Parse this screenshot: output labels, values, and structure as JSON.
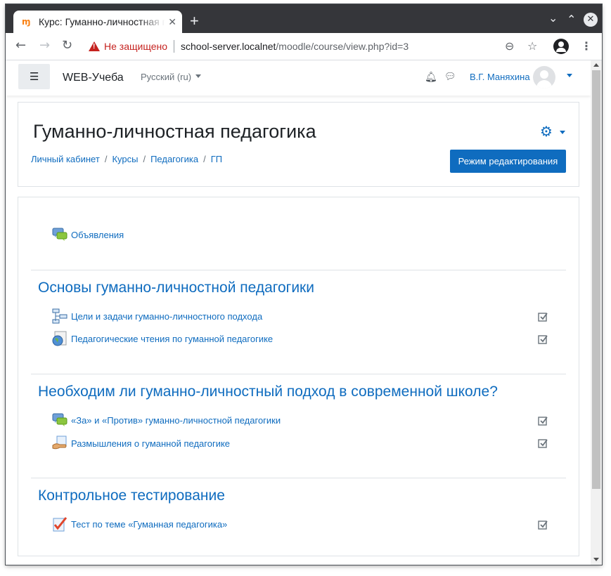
{
  "browser": {
    "tab_title": "Курс: Гуманно-личностная педагогика",
    "favicon": "moodle-favicon",
    "new_tab": "+",
    "security_label": "Не защищено",
    "url_host": "school-server.localnet",
    "url_path": "/moodle/course/view.php?id=3"
  },
  "navbar": {
    "brand": "WEB-Учеба",
    "language": "Русский (ru)",
    "user_name": "В.Г. Маняхина"
  },
  "header": {
    "title": "Гуманно-личностная педагогика",
    "breadcrumb": [
      "Личный кабинет",
      "Курсы",
      "Педагогика",
      "ГП"
    ],
    "edit_button": "Режим редактирования"
  },
  "course": {
    "general": {
      "activities": [
        {
          "label": "Объявления",
          "icon": "forum-icon"
        }
      ]
    },
    "sections": [
      {
        "title": "Основы гуманно-личностной педагогики",
        "activities": [
          {
            "label": "Цели и задачи гуманно-личностного подхода",
            "icon": "book-icon"
          },
          {
            "label": "Педагогические чтения по гуманной педагогике",
            "icon": "url-icon"
          }
        ]
      },
      {
        "title": "Необходим ли гуманно-личностный подход в современной школе?",
        "activities": [
          {
            "label": "«За» и «Против» гуманно-личностной педагогики",
            "icon": "forum-icon"
          },
          {
            "label": "Размышления о гуманной педагогике",
            "icon": "assignment-icon"
          }
        ]
      },
      {
        "title": "Контрольное тестирование",
        "activities": [
          {
            "label": "Тест по теме «Гуманная педагогика»",
            "icon": "quiz-icon"
          }
        ]
      }
    ]
  },
  "colors": {
    "link": "#0f6cbf",
    "tabstrip": "#35363a",
    "insecure": "#c5221f"
  }
}
